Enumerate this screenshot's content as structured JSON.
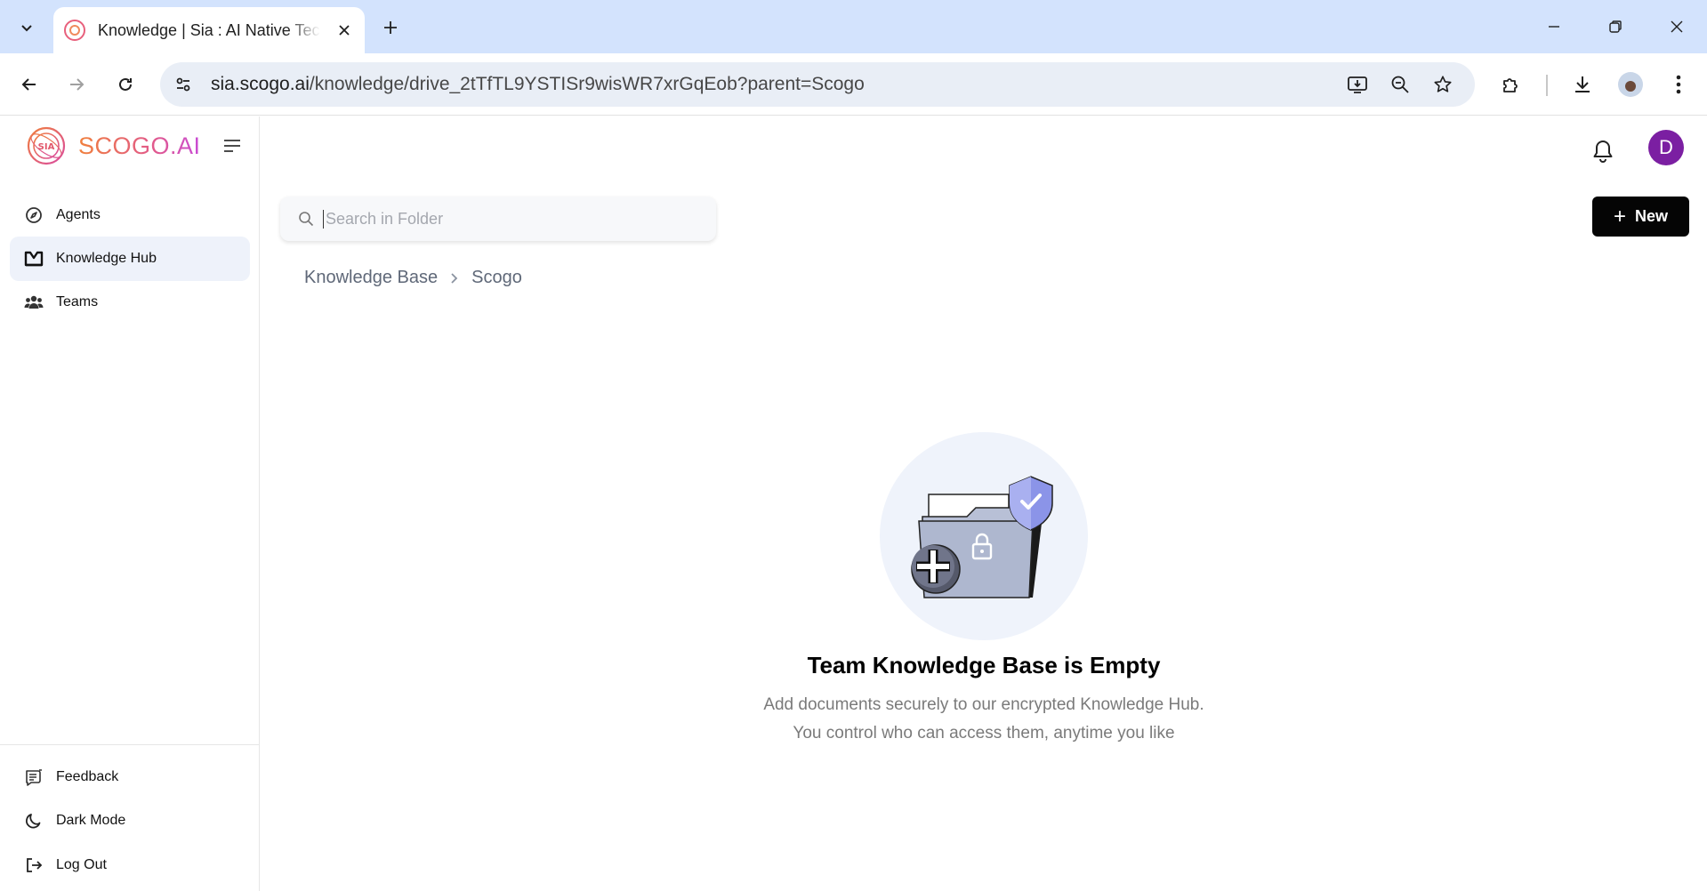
{
  "browser": {
    "tab_title": "Knowledge | Sia : AI Native Tech",
    "url_host": "sia.scogo.ai",
    "url_path": "/knowledge/drive_2tTfTL9YSTISr9wisWR7xrGqEob?parent=Scogo"
  },
  "brand": {
    "name": "SCOGO.AI"
  },
  "sidebar": {
    "items": [
      {
        "label": "Agents",
        "icon": "compass-icon"
      },
      {
        "label": "Knowledge Hub",
        "icon": "knowledge-hub-icon"
      },
      {
        "label": "Teams",
        "icon": "teams-icon"
      }
    ],
    "footer": [
      {
        "label": "Feedback",
        "icon": "feedback-icon"
      },
      {
        "label": "Dark Mode",
        "icon": "moon-icon"
      },
      {
        "label": "Log Out",
        "icon": "logout-icon"
      }
    ]
  },
  "header": {
    "avatar_initial": "D"
  },
  "search": {
    "placeholder": "Search in Folder",
    "value": ""
  },
  "actions": {
    "new_label": "New"
  },
  "breadcrumb": [
    "Knowledge Base",
    "Scogo"
  ],
  "empty_state": {
    "title": "Team Knowledge Base is Empty",
    "line1": "Add documents securely to our encrypted Knowledge Hub.",
    "line2": "You control who can access them, anytime you like"
  },
  "colors": {
    "accent_dark": "#050505",
    "avatar_bg": "#7b1fa2",
    "active_nav_bg": "#eef2fa",
    "brand_gradient_start": "#f0803c",
    "brand_gradient_end": "#c84bd6"
  }
}
